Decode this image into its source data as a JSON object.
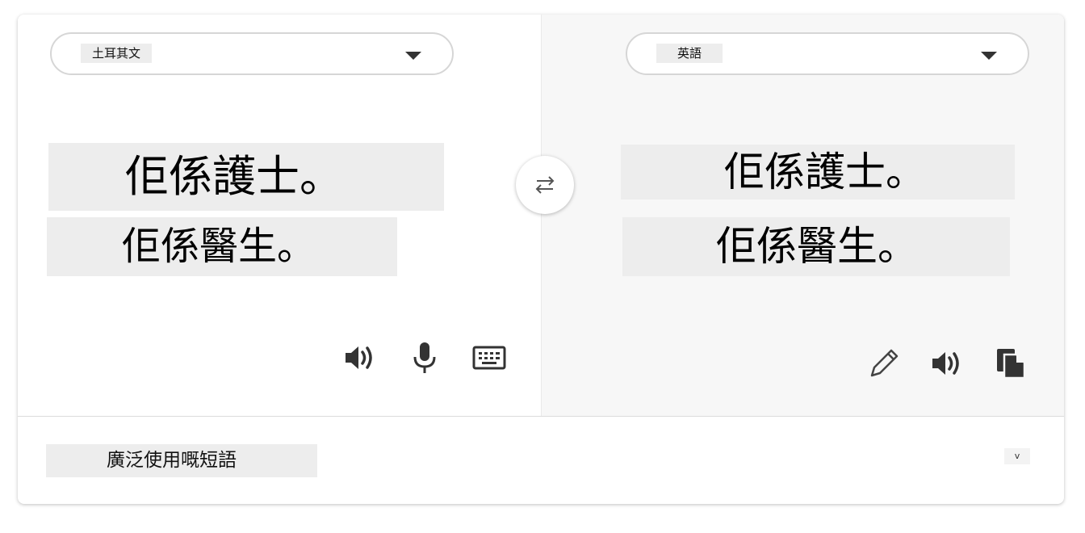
{
  "source": {
    "language": "土耳其文",
    "lines": [
      "佢係護士。",
      "佢係醫生。"
    ]
  },
  "target": {
    "language": "英語",
    "lines": [
      "佢係護士。",
      "佢係醫生。"
    ]
  },
  "icons": {
    "source_tools": [
      "speaker-icon",
      "microphone-icon",
      "keyboard-icon"
    ],
    "target_tools": [
      "pencil-icon",
      "speaker-icon",
      "copy-icon"
    ],
    "swap": "swap-arrows-icon",
    "dropdown": "caret-down-icon"
  },
  "footer": {
    "phrases_label": "廣泛使用嘅短語",
    "toggle_label": "v"
  },
  "colors": {
    "icon": "#333333",
    "text_highlight": "#ededed",
    "target_pane_bg": "#f7f7f7",
    "border": "#d6d6d6"
  }
}
